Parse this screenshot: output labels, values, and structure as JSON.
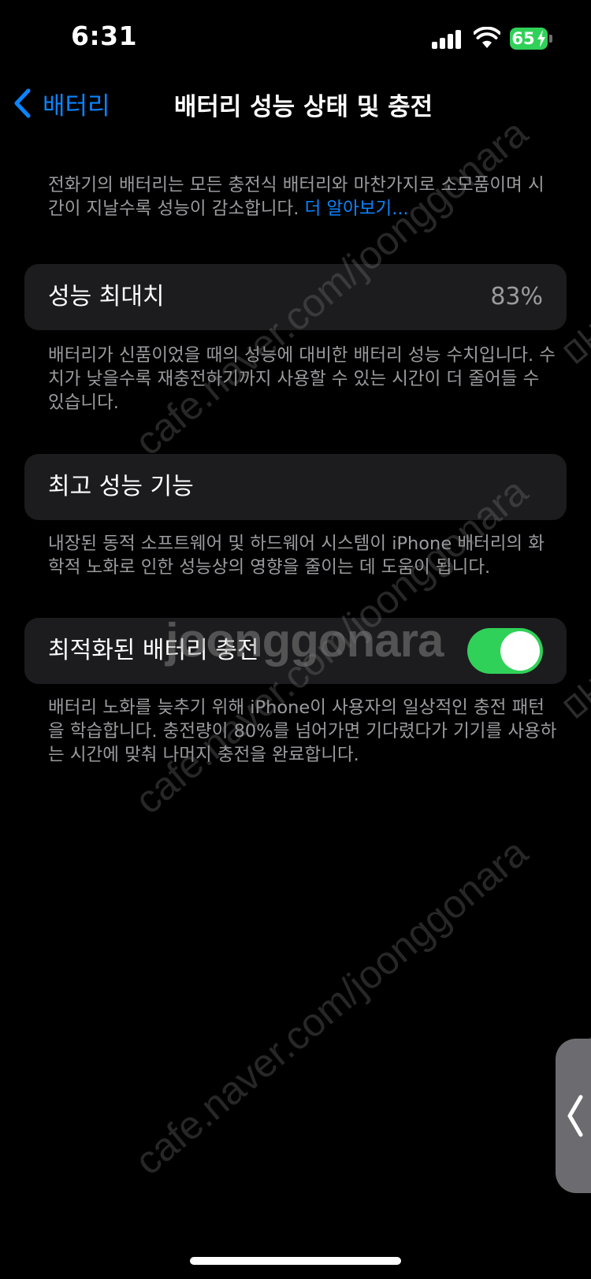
{
  "status_bar": {
    "time": "6:31",
    "battery_level": "65",
    "charging": true
  },
  "nav": {
    "back_label": "배터리",
    "title": "배터리 성능 상태 및 충전"
  },
  "intro": {
    "text": "전화기의 배터리는 모든 충전식 배터리와 마찬가지로 소모품이며 시간이 지날수록 성능이 감소합니다. ",
    "link_label": "더 알아보기..."
  },
  "maximum_capacity": {
    "label": "성능 최대치",
    "value": "83%",
    "footnote": "배터리가 신품이었을 때의 성능에 대비한 배터리 성능 수치입니다. 수치가 낮을수록 재충전하기까지 사용할 수 있는 시간이 더 줄어들 수 있습니다."
  },
  "peak_performance": {
    "label": "최고 성능 기능",
    "footnote": "내장된 동적 소프트웨어 및 하드웨어 시스템이 iPhone 배터리의 화학적 노화로 인한 성능상의 영향을 줄이는 데 도움이 됩니다."
  },
  "optimized_charging": {
    "label": "최적화된 배터리 충전",
    "enabled": true,
    "footnote": "배터리 노화를 늦추기 위해 iPhone이 사용자의 일상적인 충전 패턴을 학습합니다. 충전량이 80%를 넘어가면 기다렸다가 기기를 사용하는 시간에 맞춰 나머지 충전을 완료합니다."
  },
  "watermarks": {
    "url": "cafe.naver.com/joonggonara",
    "brand": "joonggonara",
    "kr": "마켓"
  },
  "colors": {
    "accent": "#0a84ff",
    "toggle_on": "#30d158",
    "card_bg": "#1c1c1e",
    "secondary_text": "#9b9b9f"
  }
}
